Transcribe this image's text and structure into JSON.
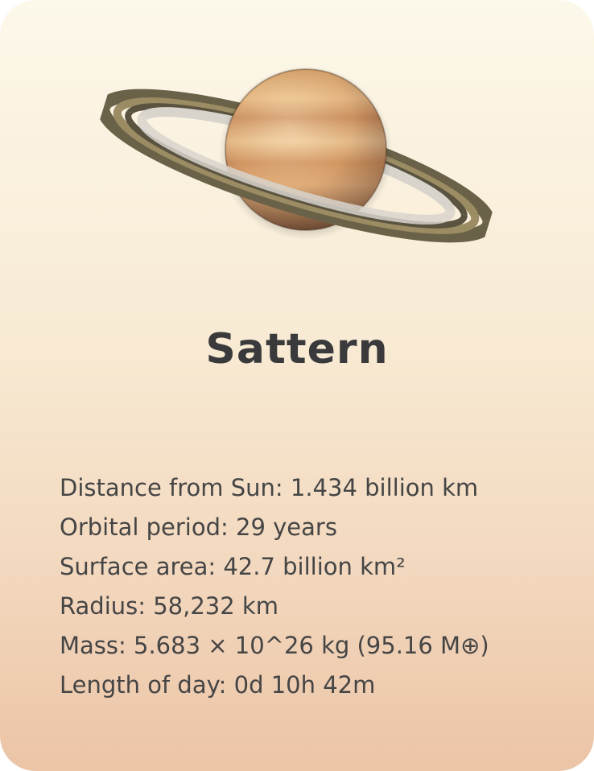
{
  "planet": {
    "name": "Sattern",
    "image_icon": "ringed-planet-image"
  },
  "facts": [
    {
      "label": "Distance from Sun",
      "value": "1.434 billion km",
      "text": "Distance from Sun: 1.434 billion km"
    },
    {
      "label": "Orbital period",
      "value": "29 years",
      "text": "Orbital period: 29 years"
    },
    {
      "label": "Surface area",
      "value": "42.7 billion km²",
      "text": "Surface area: 42.7 billion km²"
    },
    {
      "label": "Radius",
      "value": "58,232 km",
      "text": "Radius: 58,232 km"
    },
    {
      "label": "Mass",
      "value": "5.683 × 10^26 kg (95.16 M⊕)",
      "text": "Mass: 5.683 × 10^26 kg (95.16 M⊕)"
    },
    {
      "label": "Length of day",
      "value": "0d 10h 42m",
      "text": "Length of day: 0d 10h 42m"
    }
  ],
  "colors": {
    "card_top": "#fcf8ea",
    "card_bottom": "#ecc4a6",
    "text": "#454545",
    "title": "#3a3a3c"
  }
}
